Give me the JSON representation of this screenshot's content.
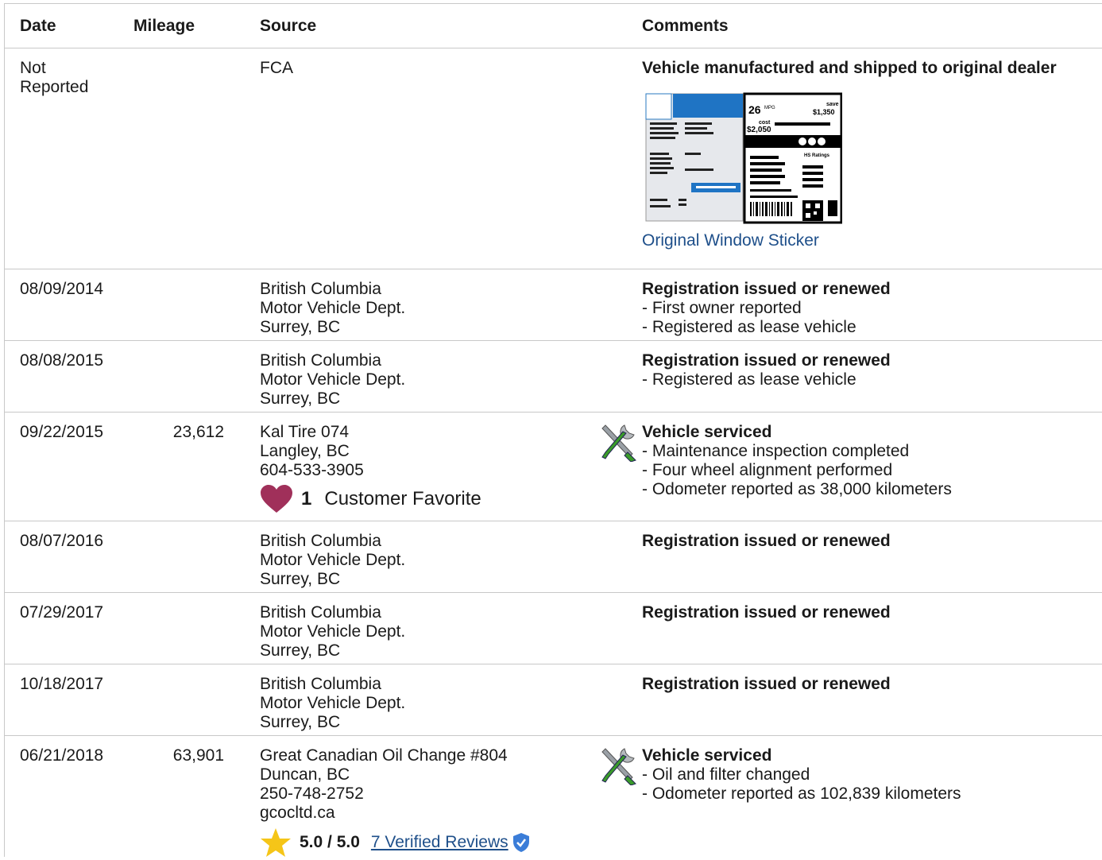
{
  "headers": {
    "date": "Date",
    "mileage": "Mileage",
    "source": "Source",
    "comments": "Comments"
  },
  "rows": [
    {
      "date": "Not Reported",
      "mileage": "",
      "source": [
        "FCA"
      ],
      "comment_title": "Vehicle manufactured and shipped to original dealer",
      "comment_lines": [],
      "link": "Original Window Sticker",
      "sticker": {
        "mpg": "26",
        "mpg_unit": "MPG",
        "save_label": "save",
        "save": "$1,350",
        "cost_label": "cost",
        "cost": "$2,050",
        "ratings": "HS Ratings"
      }
    },
    {
      "date": "08/09/2014",
      "mileage": "",
      "source": [
        "British Columbia",
        "Motor Vehicle Dept.",
        "Surrey, BC"
      ],
      "comment_title": "Registration issued or renewed",
      "comment_lines": [
        "- First owner reported",
        "- Registered as lease vehicle"
      ]
    },
    {
      "date": "08/08/2015",
      "mileage": "",
      "source": [
        "British Columbia",
        "Motor Vehicle Dept.",
        "Surrey, BC"
      ],
      "comment_title": "Registration issued or renewed",
      "comment_lines": [
        "- Registered as lease vehicle"
      ]
    },
    {
      "date": "09/22/2015",
      "mileage": "23,612",
      "source": [
        "Kal Tire 074",
        "Langley, BC",
        "604-533-3905"
      ],
      "favorite": {
        "count": "1",
        "label": "Customer Favorite"
      },
      "comment_title": "Vehicle serviced",
      "comment_lines": [
        "- Maintenance inspection completed",
        "- Four wheel alignment performed",
        "- Odometer reported as 38,000 kilometers"
      ]
    },
    {
      "date": "08/07/2016",
      "mileage": "",
      "source": [
        "British Columbia",
        "Motor Vehicle Dept.",
        "Surrey, BC"
      ],
      "comment_title": "Registration issued or renewed",
      "comment_lines": []
    },
    {
      "date": "07/29/2017",
      "mileage": "",
      "source": [
        "British Columbia",
        "Motor Vehicle Dept.",
        "Surrey, BC"
      ],
      "comment_title": "Registration issued or renewed",
      "comment_lines": []
    },
    {
      "date": "10/18/2017",
      "mileage": "",
      "source": [
        "British Columbia",
        "Motor Vehicle Dept.",
        "Surrey, BC"
      ],
      "comment_title": "Registration issued or renewed",
      "comment_lines": []
    },
    {
      "date": "06/21/2018",
      "mileage": "63,901",
      "source": [
        "Great Canadian Oil Change #804",
        "Duncan, BC",
        "250-748-2752",
        "gcocltd.ca"
      ],
      "rating": {
        "score": "5.0 / 5.0",
        "reviews": "7 Verified Reviews"
      },
      "comment_title": "Vehicle serviced",
      "comment_lines": [
        "- Oil and filter changed",
        "- Odometer reported as 102,839 kilometers"
      ]
    }
  ],
  "colors": {
    "border": "#c8c8c8",
    "link": "#1e4f8a",
    "heart": "#a0305a",
    "star": "#f5c518",
    "badge": "#3b7dd8"
  }
}
